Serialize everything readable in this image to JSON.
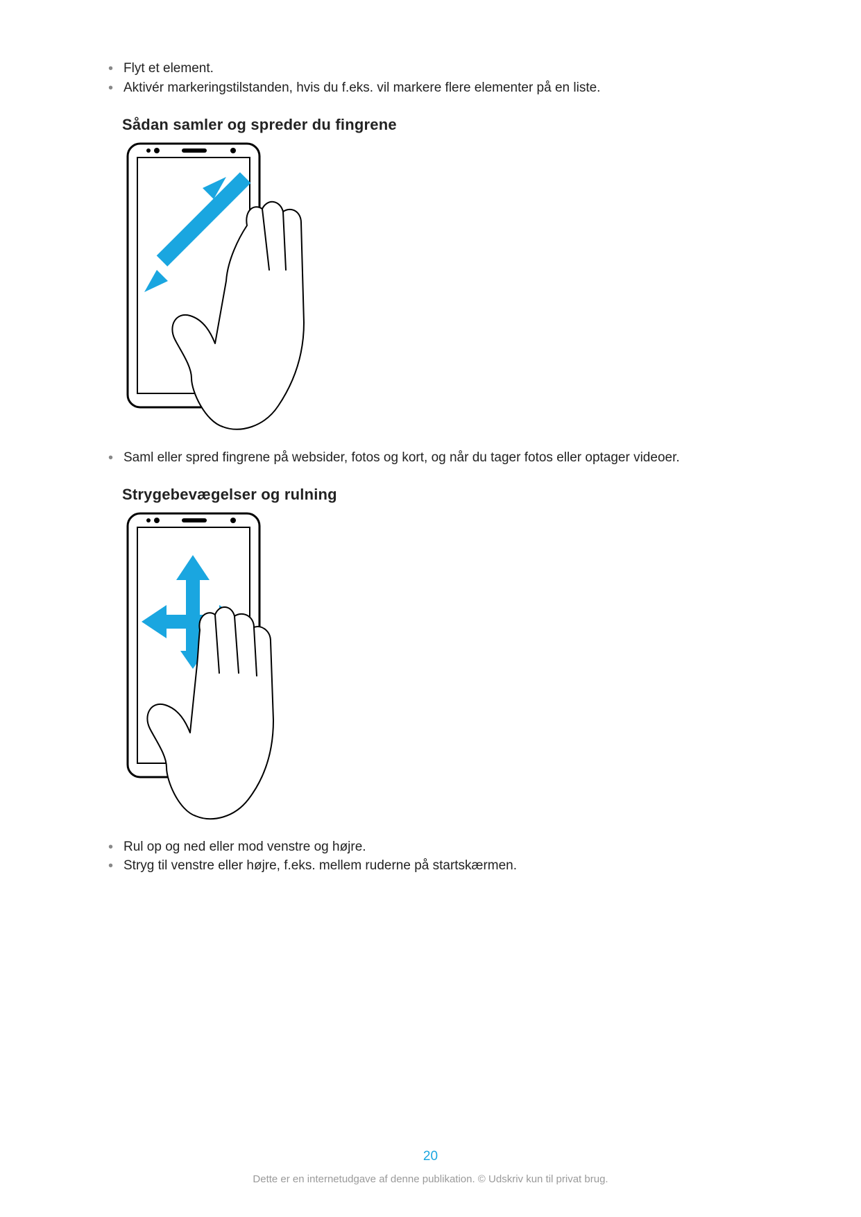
{
  "bullets_top": [
    "Flyt et element.",
    "Aktivér markeringstilstanden, hvis du f.eks. vil markere flere elementer på en liste."
  ],
  "section1": {
    "heading": "Sådan samler og spreder du fingrene",
    "bullets": [
      "Saml eller spred fingrene på websider, fotos og kort, og når du tager fotos eller optager videoer."
    ]
  },
  "section2": {
    "heading": "Strygebevægelser og rulning",
    "bullets": [
      "Rul op og ned eller mod venstre og højre.",
      "Stryg til venstre eller højre, f.eks. mellem ruderne på startskærmen."
    ]
  },
  "page_number": "20",
  "footer": "Dette er en internetudgave af denne publikation. © Udskriv kun til privat brug."
}
